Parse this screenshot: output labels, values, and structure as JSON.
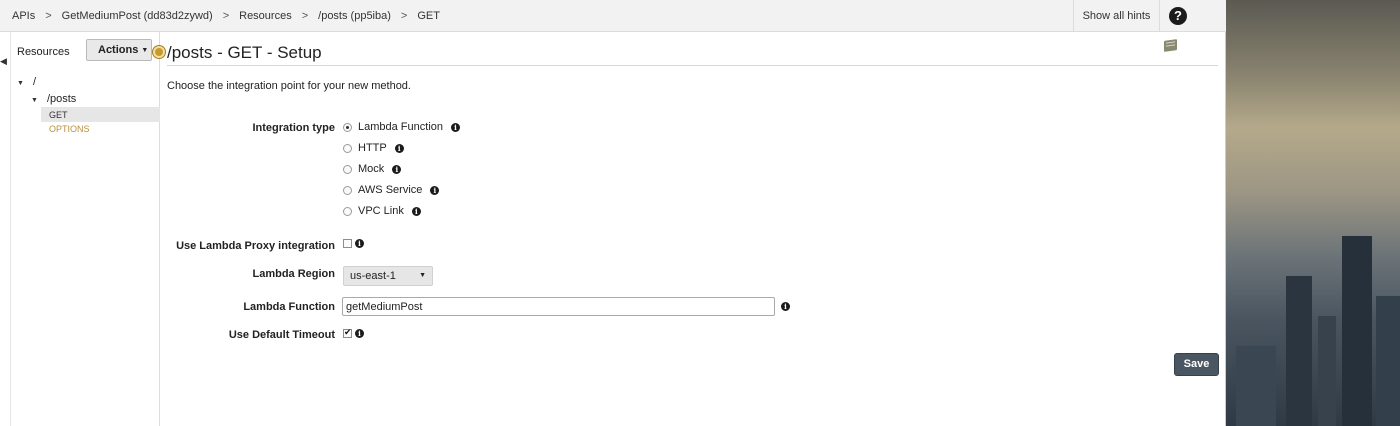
{
  "breadcrumb": [
    "APIs",
    "GetMediumPost (dd83d2zywd)",
    "Resources",
    "/posts (pp5iba)",
    "GET"
  ],
  "breadcrumb_separator": ">",
  "header": {
    "hints_label": "Show all hints",
    "help_label": "?"
  },
  "resources": {
    "title": "Resources",
    "actions_label": "Actions",
    "tree": {
      "root": "/",
      "child": "/posts",
      "methods": [
        "GET",
        "OPTIONS"
      ],
      "selected_method": "GET"
    }
  },
  "main": {
    "title": "/posts - GET - Setup",
    "intro": "Choose the integration point for your new method.",
    "integration_type": {
      "label": "Integration type",
      "options": [
        "Lambda Function",
        "HTTP",
        "Mock",
        "AWS Service",
        "VPC Link"
      ],
      "selected": "Lambda Function"
    },
    "proxy": {
      "label": "Use Lambda Proxy integration",
      "checked": false
    },
    "region": {
      "label": "Lambda Region",
      "value": "us-east-1"
    },
    "function": {
      "label": "Lambda Function",
      "value": "getMediumPost"
    },
    "timeout": {
      "label": "Use Default Timeout",
      "checked": true
    },
    "save_label": "Save"
  },
  "colors": {
    "save_button": "#4a5763",
    "options_method": "#b7923c",
    "topbar": "#f2f2f2"
  }
}
